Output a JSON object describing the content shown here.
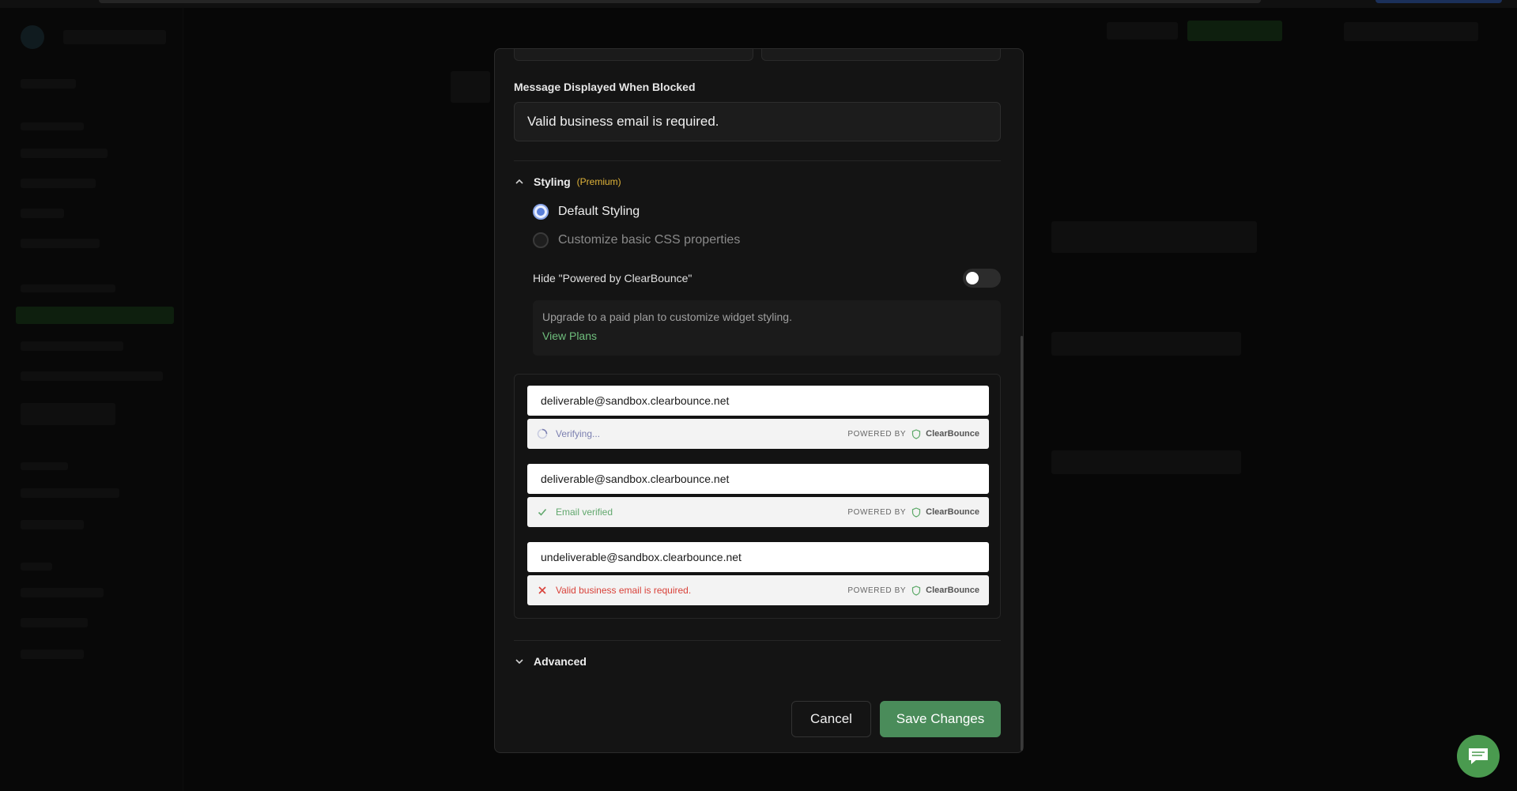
{
  "modal": {
    "message_label": "Message Displayed When Blocked",
    "message_value": "Valid business email is required.",
    "styling": {
      "title": "Styling",
      "badge": "(Premium)",
      "options": [
        {
          "label": "Default Styling",
          "selected": true
        },
        {
          "label": "Customize basic CSS properties",
          "selected": false
        }
      ],
      "hide_powered_label": "Hide \"Powered by ClearBounce\"",
      "hide_powered_on": false,
      "upgrade_text": "Upgrade to a paid plan to customize widget styling.",
      "view_plans": "View Plans"
    },
    "preview": {
      "powered_by": "POWERED BY",
      "brand": "ClearBounce",
      "rows": [
        {
          "email": "deliverable@sandbox.clearbounce.net",
          "status": "Verifying...",
          "state": "verifying"
        },
        {
          "email": "deliverable@sandbox.clearbounce.net",
          "status": "Email verified",
          "state": "verified"
        },
        {
          "email": "undeliverable@sandbox.clearbounce.net",
          "status": "Valid business email is required.",
          "state": "error"
        }
      ]
    },
    "advanced": {
      "title": "Advanced"
    },
    "buttons": {
      "cancel": "Cancel",
      "save": "Save Changes"
    }
  },
  "colors": {
    "accent_green": "#4a8c5a",
    "premium": "#e0b43a",
    "error": "#d9423a",
    "verified": "#62a86e"
  }
}
